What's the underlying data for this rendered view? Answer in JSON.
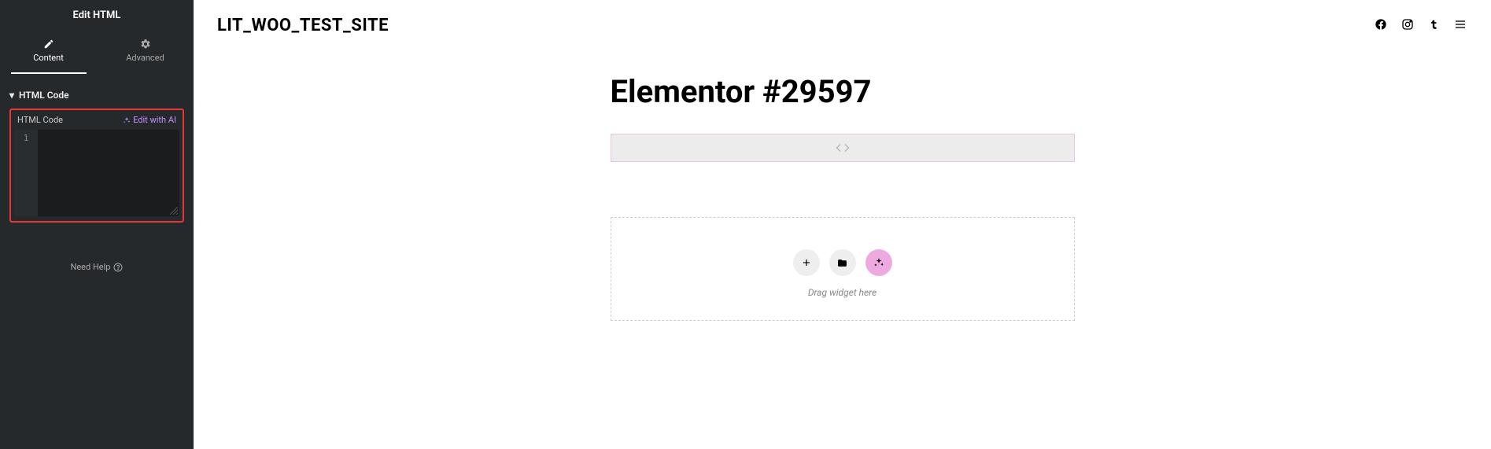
{
  "sidebar": {
    "title": "Edit HTML",
    "tabs": {
      "content": "Content",
      "advanced": "Advanced"
    },
    "section": {
      "title": "HTML Code"
    },
    "field": {
      "label": "HTML Code",
      "ai_link": "Edit with AI",
      "line_number": "1"
    },
    "help": "Need Help"
  },
  "site": {
    "title": "LIT_WOO_TEST_SITE"
  },
  "page": {
    "heading": "Elementor #29597"
  },
  "dropzone": {
    "label": "Drag widget here"
  }
}
